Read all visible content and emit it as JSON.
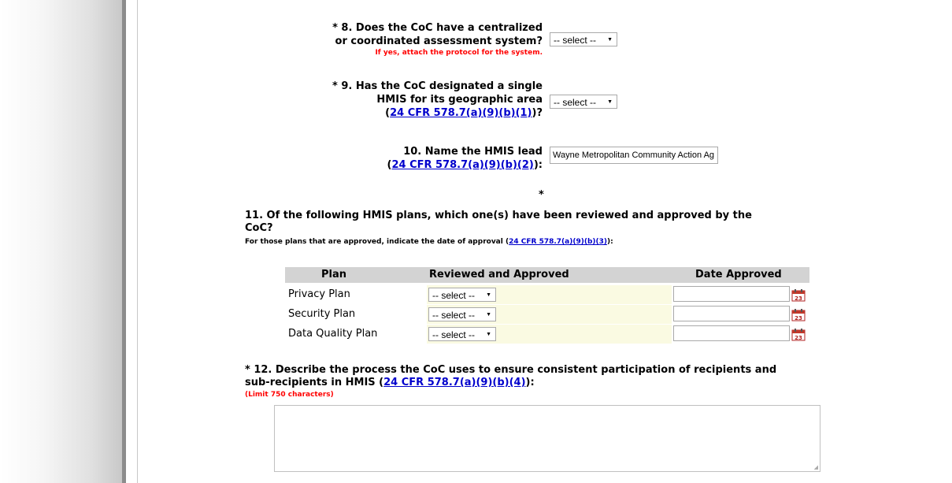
{
  "q8": {
    "label_line1": "* 8. Does the CoC have a centralized",
    "label_line2": "or coordinated assessment system?",
    "note": "If yes, attach the protocol for the system.",
    "select_value": "-- select --"
  },
  "q9": {
    "label_line1": "* 9. Has the CoC designated a single",
    "label_line2": "HMIS for its geographic area",
    "link": "24 CFR 578.7(a)(9)(b)(1)",
    "prefix": "(",
    "suffix": ")?",
    "select_value": "-- select --"
  },
  "q10": {
    "label_line1": "10. Name the HMIS lead",
    "link": "24 CFR 578.7(a)(9)(b)(2)",
    "prefix": "(",
    "suffix": "):",
    "input_value": "Wayne Metropolitan Community Action Ag"
  },
  "q11": {
    "asterisk": "*",
    "title_line1": "11. Of the following HMIS plans, which one(s) have been reviewed and approved by the",
    "title_line2": "CoC?",
    "instruction": "For those plans that are approved, indicate the date of approval (",
    "link": "24 CFR 578.7(a)(9)(b)(3)",
    "instruction_suffix": "):",
    "table": {
      "headers": [
        "Plan",
        "Reviewed and Approved",
        "Date Approved"
      ],
      "rows": [
        {
          "plan": "Privacy Plan",
          "select": "-- select --",
          "date": "",
          "cal": "23"
        },
        {
          "plan": "Security Plan",
          "select": "-- select --",
          "date": "",
          "cal": "23"
        },
        {
          "plan": "Data Quality Plan",
          "select": "-- select --",
          "date": "",
          "cal": "23"
        }
      ]
    }
  },
  "q12": {
    "title_line1": "* 12. Describe the process the CoC uses to ensure consistent participation of recipients and",
    "title_line2": "sub-recipients in HMIS (",
    "link": "24 CFR 578.7(a)(9)(b)(4)",
    "suffix": "):",
    "limit": "(Limit 750 characters)",
    "textarea_value": ""
  },
  "colors": {
    "link": "#0000cc",
    "required_note": "#ff0000",
    "table_header_bg": "#d3d3d3",
    "highlight_cell": "#fafae2"
  }
}
